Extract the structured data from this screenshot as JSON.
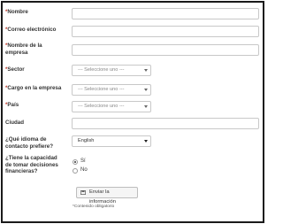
{
  "form": {
    "required_mark": "*",
    "fields": {
      "nombre": {
        "label": "Nombre"
      },
      "correo": {
        "label": "Correo electrónico"
      },
      "empresa_line1": {
        "label": "Nombre de la"
      },
      "empresa_line2": {
        "label": "empresa"
      },
      "sector": {
        "label": "Sector",
        "value": "--- Seleccione uno ---"
      },
      "cargo": {
        "label": "Cargo en la empresa",
        "value": "--- Seleccione uno ---"
      },
      "pais": {
        "label": "País",
        "value": "--- Seleccione uno ---"
      },
      "ciudad": {
        "label": "Ciudad"
      },
      "idioma_line1": {
        "label": "¿Qué idioma de"
      },
      "idioma_line2": {
        "label": "contacto prefiere?"
      },
      "idioma_value": "English",
      "capacidad_line1": {
        "label": "¿Tiene la capacidad"
      },
      "capacidad_line2": {
        "label": "de tomar decisiones"
      },
      "capacidad_line3": {
        "label": "financieras?"
      }
    },
    "radio_options": [
      {
        "label": "Sí",
        "checked": true
      },
      {
        "label": "No",
        "checked": false
      }
    ],
    "submit_label": "Enviar la información",
    "required_note": "*Contenido obligatorio",
    "colors": {
      "required": "#c0392b",
      "border": "#c8c8c8"
    }
  }
}
